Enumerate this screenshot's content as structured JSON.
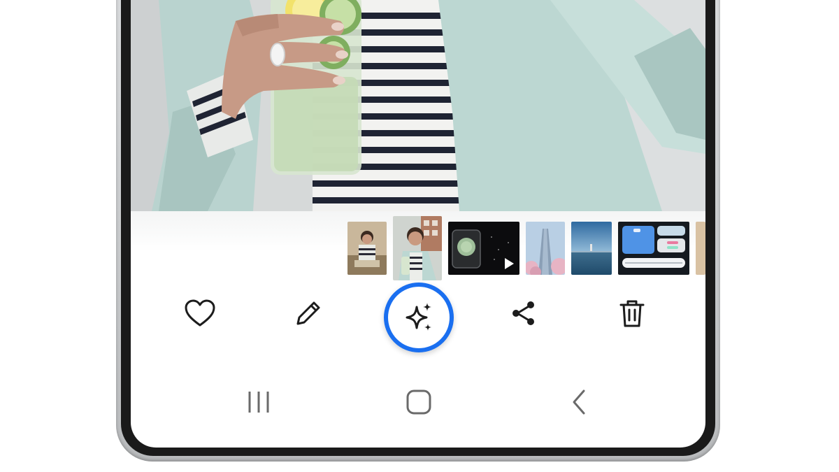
{
  "photo": {
    "subject": "person-holding-cucumber-drink",
    "colors": {
      "jacket": "#bcd7d2",
      "stripe_dark": "#1f2433",
      "glass": "#cfe1c6",
      "lemon": "#f2e26b"
    }
  },
  "thumbnails": [
    {
      "name": "thumb-person-sitting",
      "selected": false
    },
    {
      "name": "thumb-person-selfie",
      "selected": true
    },
    {
      "name": "thumb-video-dark",
      "selected": false,
      "video": true
    },
    {
      "name": "thumb-tower",
      "selected": false
    },
    {
      "name": "thumb-lake",
      "selected": false
    },
    {
      "name": "thumb-screenshot",
      "selected": false
    }
  ],
  "actions": [
    {
      "name": "favorite-button",
      "icon": "heart-icon"
    },
    {
      "name": "edit-button",
      "icon": "pencil-icon"
    },
    {
      "name": "ai-edit-button",
      "icon": "sparkles-icon",
      "highlight_color": "#1a6ff0"
    },
    {
      "name": "share-button",
      "icon": "share-icon"
    },
    {
      "name": "delete-button",
      "icon": "trash-icon"
    }
  ],
  "navigation": [
    {
      "name": "recent-apps-button",
      "icon": "recents-icon"
    },
    {
      "name": "home-button",
      "icon": "home-icon"
    },
    {
      "name": "back-button",
      "icon": "back-chevron-icon"
    }
  ]
}
